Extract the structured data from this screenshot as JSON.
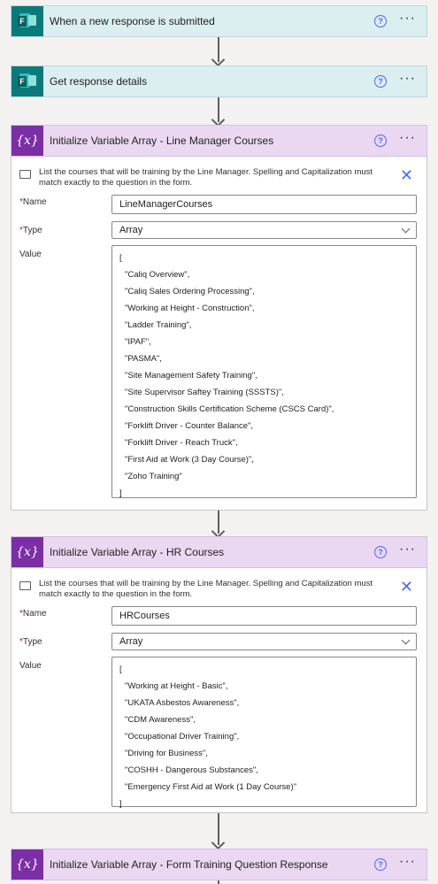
{
  "steps": {
    "trigger": {
      "title": "When a new response is submitted",
      "help": "?",
      "more": "···"
    },
    "get_details": {
      "title": "Get response details",
      "help": "?",
      "more": "···"
    },
    "var1": {
      "title": "Initialize Variable Array - Line Manager Courses",
      "var_icon": "{x}",
      "help": "?",
      "more": "···",
      "info": "List the courses that will be training by the Line Manager. Spelling and Capitalization must match exactly to the question in the form.",
      "close": "✕",
      "name_label": "Name",
      "name_value": "LineManagerCourses",
      "type_label": "Type",
      "type_value": "Array",
      "value_label": "Value",
      "open_bracket": "[",
      "items": [
        "\"Caliq Overview\",",
        "\"Caliq Sales Ordering Processing\",",
        "\"Working at Height - Construction\",",
        "\"Ladder Training\",",
        "\"IPAF\",",
        "\"PASMA\",",
        "\"Site Management Safety Training\",",
        "\"Site Supervisor Saftey Training (SSSTS)\",",
        "\"Construction Skills Certification Scheme (CSCS Card)\",",
        "\"Forklift Driver - Counter Balance\",",
        "\"Forklift Driver - Reach Truck\",",
        "\"First Aid at Work (3 Day Course)\",",
        "\"Zoho Training\""
      ],
      "close_bracket": "]"
    },
    "var2": {
      "title": "Initialize Variable Array - HR Courses",
      "var_icon": "{x}",
      "help": "?",
      "more": "···",
      "info": "List the courses that will be training by the Line Manager. Spelling and Capitalization must match exactly to the question in the form.",
      "close": "✕",
      "name_label": "Name",
      "name_value": "HRCourses",
      "type_label": "Type",
      "type_value": "Array",
      "value_label": "Value",
      "open_bracket": "[",
      "items": [
        "\"Working at Height - Basic\",",
        "\"UKATA Asbestos Awareness\",",
        "\"CDM Awareness\",",
        "\"Occupational Driver Training\",",
        "\"Driving for Business\",",
        "\"COSHH - Dangerous Substances\",",
        "\"Emergency First Aid at Work (1 Day Course)\""
      ],
      "close_bracket": "]"
    },
    "var3": {
      "title": "Initialize Variable Array - Form Training Question Response",
      "var_icon": "{x}",
      "help": "?",
      "more": "···"
    }
  },
  "colors": {
    "forms_teal": "#0a7a7a",
    "variable_purple": "#7b2ea6",
    "trigger_bg": "#dbeef0",
    "variable_bg": "#ead8f3",
    "link_blue": "#4f6bed"
  }
}
